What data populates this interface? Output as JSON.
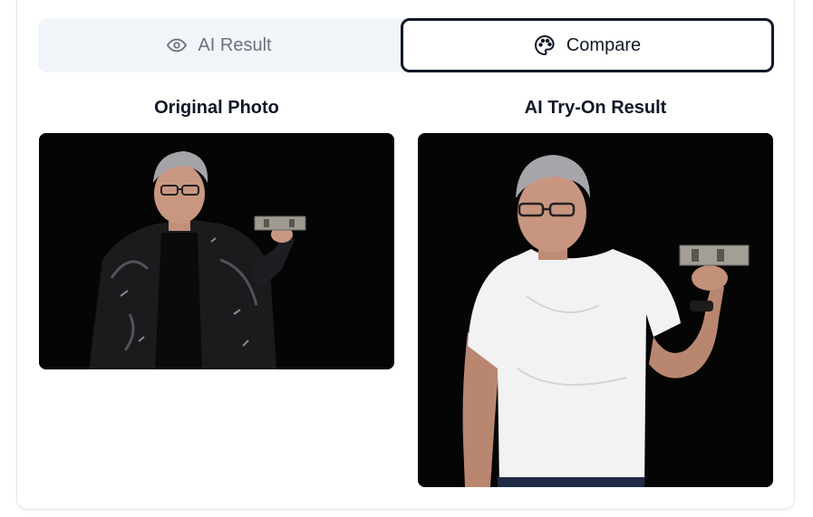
{
  "tabs": {
    "ai_result": {
      "label": "AI Result",
      "icon": "eye-icon",
      "active": false
    },
    "compare": {
      "label": "Compare",
      "icon": "palette-icon",
      "active": true
    }
  },
  "compare": {
    "original_title": "Original Photo",
    "result_title": "AI Try-On Result"
  },
  "colors": {
    "tab_bg": "#f1f4f8",
    "active_border": "#111827",
    "inactive_text": "#6b7280",
    "photo_bg": "#050505"
  }
}
